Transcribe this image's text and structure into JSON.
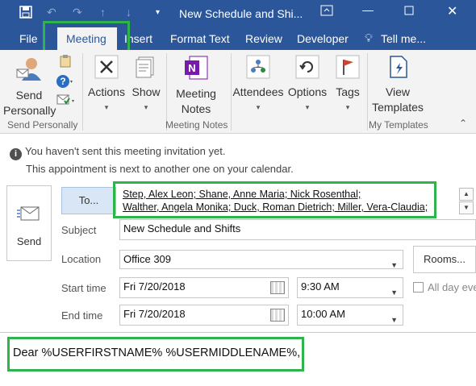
{
  "window": {
    "title": "New Schedule and Shi...",
    "icons": [
      "save-icon",
      "undo-icon",
      "redo-icon",
      "up-arrow-icon",
      "down-arrow-icon",
      "customize-icon"
    ],
    "controls": [
      "restore-ribbon-icon",
      "minimize-icon",
      "maximize-icon",
      "close-icon"
    ]
  },
  "tabs": {
    "file": "File",
    "meeting": "Meeting",
    "insert": "Insert",
    "format_text": "Format Text",
    "review": "Review",
    "developer": "Developer",
    "tell_me": "Tell me..."
  },
  "ribbon": {
    "send_personally": {
      "line1": "Send",
      "line2": "Personally",
      "group": "Send Personally"
    },
    "actions": "Actions",
    "show": "Show",
    "meeting_notes": {
      "line1": "Meeting",
      "line2": "Notes",
      "group": "Meeting Notes"
    },
    "attendees": "Attendees",
    "options": "Options",
    "tags": "Tags",
    "view_templates": {
      "line1": "View",
      "line2": "Templates",
      "group": "My Templates"
    }
  },
  "info": {
    "line1": "You haven't sent this meeting invitation yet.",
    "line2": "This appointment is next to another one on your calendar."
  },
  "form": {
    "send_label": "Send",
    "to_label": "To...",
    "recipients_line1": "Step, Alex Leon; Shane, Anne Maria; Nick Rosenthal;",
    "recipients_line2": "Walther, Angela Monika; Duck, Roman Dietrich; Miller, Vera-Claudia;",
    "subject_label": "Subject",
    "subject_value": "New Schedule and Shifts",
    "location_label": "Location",
    "location_value": "Office 309",
    "rooms_label": "Rooms...",
    "start_label": "Start time",
    "start_date": "Fri 7/20/2018",
    "start_time": "9:30 AM",
    "end_label": "End time",
    "end_date": "Fri 7/20/2018",
    "end_time": "10:00 AM",
    "all_day_label": "All day eve"
  },
  "body": {
    "text": "Dear %USERFIRSTNAME% %USERMIDDLENAME%,"
  },
  "colors": {
    "title_bar": "#2b579a",
    "highlight": "#2fb44b",
    "ribbon_bg": "#f3f3f3"
  }
}
